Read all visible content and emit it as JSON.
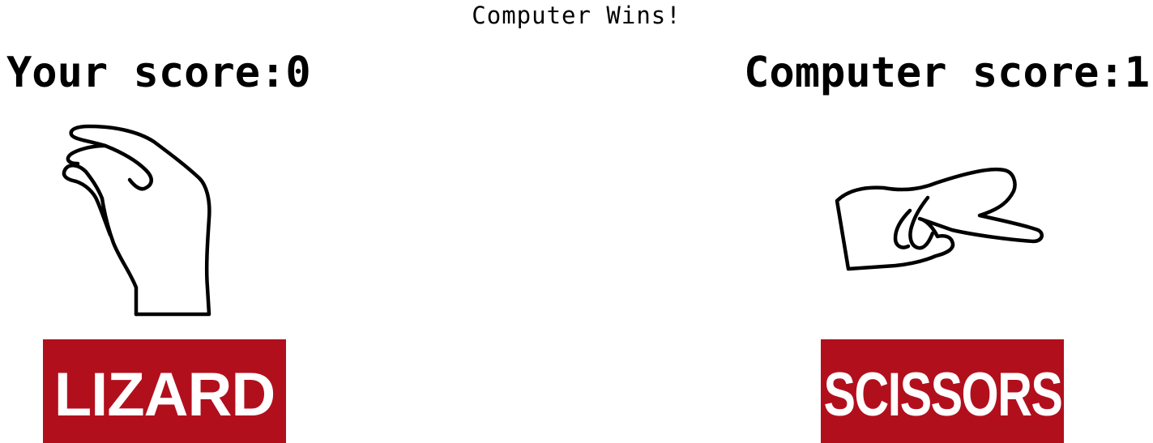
{
  "result_text": "Computer Wins!",
  "player": {
    "score_label": "Your score:",
    "score_value": "0",
    "score_text": "Your score:0",
    "choice": "LIZARD",
    "hand_icon": "lizard-hand-icon"
  },
  "computer": {
    "score_label": "Computer score:",
    "score_value": "1",
    "score_text": "Computer score:1",
    "choice": "SCISSORS",
    "hand_icon": "scissors-hand-icon"
  },
  "colors": {
    "choice_background": "#b20f1d",
    "choice_text": "#ffffff",
    "text": "#000000",
    "background": "#ffffff"
  }
}
